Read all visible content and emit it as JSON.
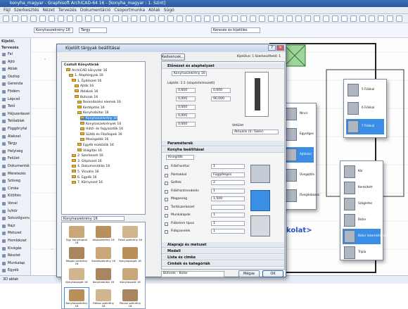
{
  "window": {
    "title": "konyha_magyar - Graphisoft ArchiCAD-64 16 - [konyha_magyar : 1. Szint]"
  },
  "menubar": {
    "items": [
      "Fájl",
      "Szerkesztés",
      "Nézet",
      "Tervezés",
      "Dokumentáció",
      "Csoportmunka",
      "Ablak",
      "Súgó"
    ]
  },
  "toolbar": {
    "floor_field": "Konyhaszekrény 16",
    "info_button": "Tárgy",
    "find_button": "Keresés és kijelölés"
  },
  "toolbox": {
    "header_select": "Kijelöl.",
    "header_design": "Tervezés",
    "tools": [
      "Fal",
      "Ajtó",
      "Ablak",
      "Oszlop",
      "Gerenda",
      "Födém",
      "Lépcső",
      "Tető",
      "Héjszerkezet",
      "Tetőablak",
      "Függönyfal",
      "Alakzat",
      "Tárgy",
      "Helyiség",
      "Felület",
      "Dokumentálás",
      "Méretezés",
      "Szöveg",
      "Cimke",
      "Kitöltés",
      "Vonal",
      "Ív/kör",
      "Sokszögvonal",
      "Rajz",
      "Metszet",
      "Homlokzat",
      "Kivágás",
      "Részlet",
      "Munkalap",
      "Egyéb"
    ]
  },
  "status": {
    "text": "3D ablak"
  },
  "dialog": {
    "title": "Kijelölt tárgyak beállításai",
    "favorites_button": "Kedvencek...",
    "selected_info": "Kijelölve: 1 Szerkeszthető: 1",
    "tree_root": "Csatolt Könyvtárak",
    "tree_items": [
      "ArchiCAD könyvtár 16",
      "1. Alaptárgyak 16",
      "1. Építészet 16",
      "Ajtók 16",
      "Ablakok 16",
      "Bútorok 16",
      "Berendezési elemek 16",
      "Kertépítés 16",
      "Konyhabútor 16",
      "Konyhaszekrény 16",
      "Konyhaszekrények 16",
      "Hűtő- és fagyasztók 16",
      "Sütők és Főzőlapok 16",
      "Mosogatók 16",
      "Egyéb eszközök 16",
      "Világítás 16",
      "2. Szerkezeti 16",
      "3. Gépészet 16",
      "4. Dokumentálás 16",
      "5. Vizuális 16",
      "6. Egyéb 16",
      "7. Környezet 16"
    ],
    "library_field": "Konyhaszekrény 16",
    "thumbs": [
      "Egy. konyhapult 16",
      "Alsószekrény 16",
      "Felső szekrény 16",
      "Magas szekrény 16",
      "Sarokszekrény 16",
      "Konyhasziget 16",
      "Konyhasziget 16",
      "Konyhabútor 16",
      "Konyhaszett 16",
      "Konyhaszekrény 16",
      "Fiókos szekrény 16",
      "Polcos szekrény 16"
    ],
    "settings": {
      "preview_header": "Előnézet és alaphelyzet",
      "preview_field": "Konyhaszekrény 16",
      "dim_a": "0,600",
      "dim_b": "0,600",
      "offset_label": "Lépték: 1:1 (alapértelmezett)",
      "height_a": "0,000",
      "height_b": "90,000",
      "values": [
        "0,000",
        "0,000",
        "0,000"
      ],
      "view_label": "Vetület",
      "view_value": "Aktuális (0: Tükör)",
      "params_header": "Paraméterek",
      "kitchen_header": "Konyha beállításai",
      "kitchen_select": "Kisegítők",
      "fields": [
        {
          "label": "Fiókfronttal",
          "value": "1"
        },
        {
          "label": "Pántokkal",
          "value": "Függőleges"
        },
        {
          "label": "Szélek",
          "value": "2"
        },
        {
          "label": "Fiókfrontrendelés",
          "value": "1"
        },
        {
          "label": "Magasság",
          "value": "1,500"
        },
        {
          "label": "Tartószerkezet",
          "value": ""
        },
        {
          "label": "Munkalapok",
          "value": "1"
        },
        {
          "label": "Fiókelem típus",
          "value": "1"
        },
        {
          "label": "Fiókpanelek",
          "value": "1"
        }
      ],
      "arrow_note": "",
      "lower_sections": [
        "Alaprajz és metszet",
        "Modell",
        "Lista és cimke",
        "Címkék és kategóriák"
      ]
    },
    "layer_select": "Bútorok - Bútor",
    "cancel_button": "Mégse",
    "ok_button": "OK"
  },
  "popup_a": {
    "items": [
      "Nincs",
      "Egységes",
      "Ajtókkal",
      "Üvegajtós",
      "Üvegdobozos"
    ],
    "selected": 2
  },
  "popup_b": {
    "items": [
      "5 Fiókkal",
      "6 Fiókkal",
      "7 Fiókkal"
    ],
    "selected": 2
  },
  "popup_c": {
    "items": [
      "Kör",
      "Kerekített",
      "Szögletes",
      "Bútor",
      "Bútor lekerekítéssel",
      "Tripla"
    ],
    "selected": 4
  },
  "canvas": {
    "label": "kolat>"
  }
}
